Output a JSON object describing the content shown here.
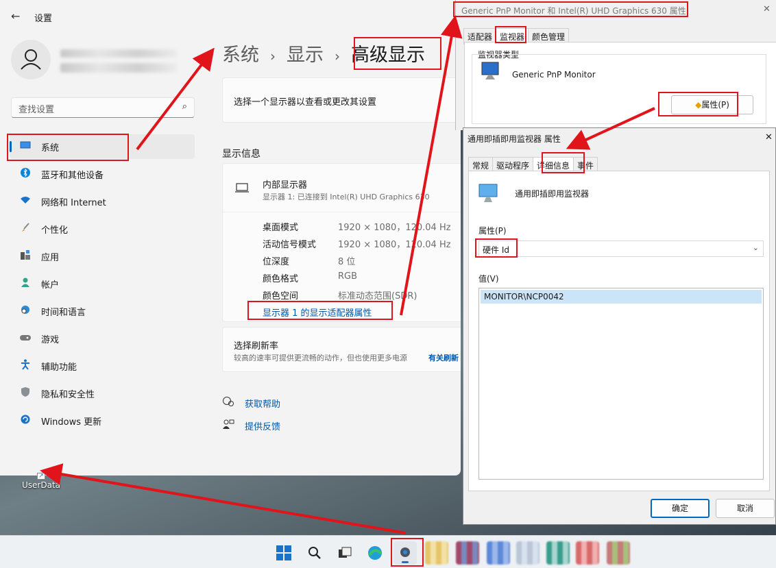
{
  "settings": {
    "window_title": "设置",
    "search_placeholder": "查找设置",
    "nav": [
      {
        "label": "系统",
        "icon": "monitor-icon",
        "selected": true
      },
      {
        "label": "蓝牙和其他设备",
        "icon": "bluetooth-icon"
      },
      {
        "label": "网络和 Internet",
        "icon": "wifi-icon"
      },
      {
        "label": "个性化",
        "icon": "brush-icon"
      },
      {
        "label": "应用",
        "icon": "apps-icon"
      },
      {
        "label": "帐户",
        "icon": "person-icon"
      },
      {
        "label": "时间和语言",
        "icon": "clock-globe-icon"
      },
      {
        "label": "游戏",
        "icon": "gamepad-icon"
      },
      {
        "label": "辅助功能",
        "icon": "accessibility-icon"
      },
      {
        "label": "隐私和安全性",
        "icon": "shield-icon"
      },
      {
        "label": "Windows 更新",
        "icon": "update-icon"
      }
    ],
    "breadcrumb": {
      "part1": "系统",
      "part2": "显示",
      "current": "高级显示",
      "separator": "›"
    },
    "select_display_text": "选择一个显示器以查看或更改其设置",
    "display_info_heading": "显示信息",
    "monitor_name": "内部显示器",
    "monitor_sub": "显示器 1: 已连接到 Intel(R) UHD Graphics 630",
    "info_rows": [
      {
        "label": "桌面模式",
        "value": "1920 × 1080，120.04 Hz"
      },
      {
        "label": "活动信号模式",
        "value": "1920 × 1080，120.04 Hz"
      },
      {
        "label": "位深度",
        "value": "8 位"
      },
      {
        "label": "颜色格式",
        "value": "RGB"
      },
      {
        "label": "颜色空间",
        "value": "标准动态范围(SDR)"
      }
    ],
    "adapter_link": "显示器 1 的显示适配器属性",
    "refresh_title": "选择刷新率",
    "refresh_desc": "较高的速率可提供更流畅的动作，但也使用更多电源",
    "refresh_more": "有关刷新",
    "help_link": "获取帮助",
    "feedback_link": "提供反馈"
  },
  "desktop": {
    "icon_label": "UserData"
  },
  "monitor_dialog": {
    "title": "Generic PnP Monitor 和 Intel(R) UHD Graphics 630 属性",
    "tabs": [
      "适配器",
      "监视器",
      "颜色管理"
    ],
    "group_label": "监视器类型",
    "monitor_type": "Generic PnP Monitor",
    "properties_button": "属性(P)",
    "close_glyph": "✕"
  },
  "details_dialog": {
    "title": "通用即插即用监视器 属性",
    "tabs": [
      "常规",
      "驱动程序",
      "详细信息",
      "事件"
    ],
    "device_name": "通用即插即用监视器",
    "property_label": "属性(P)",
    "property_selected": "硬件 Id",
    "value_label": "值(V)",
    "values": [
      "MONITOR\\NCP0042"
    ],
    "ok_button": "确定",
    "cancel_button": "取消",
    "close_glyph": "✕"
  },
  "colors": {
    "accent": "#0067c0",
    "annotation": "#e0141a",
    "link": "#0057a8"
  }
}
